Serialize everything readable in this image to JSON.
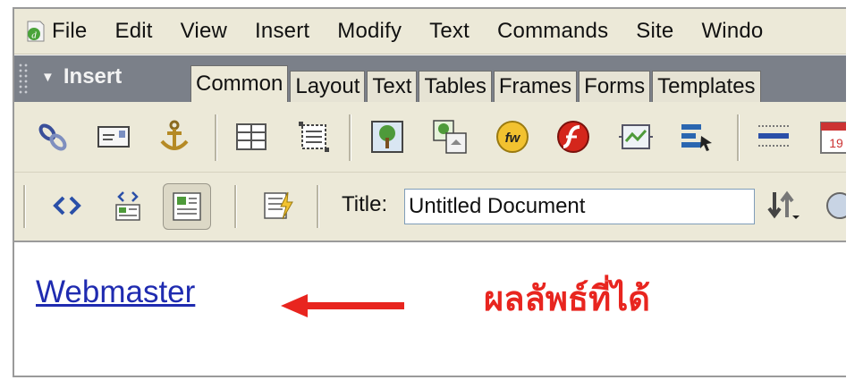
{
  "menubar": {
    "items": [
      "File",
      "Edit",
      "View",
      "Insert",
      "Modify",
      "Text",
      "Commands",
      "Site",
      "Windo"
    ]
  },
  "insert_bar": {
    "title": "Insert",
    "tabs": [
      "Common",
      "Layout",
      "Text",
      "Tables",
      "Frames",
      "Forms",
      "Templates"
    ],
    "active_tab": "Common"
  },
  "common_toolbar": {
    "icons": [
      "hyperlink-icon",
      "email-link-icon",
      "named-anchor-icon",
      "table-icon",
      "layer-icon",
      "image-icon",
      "rollover-image-icon",
      "fireworks-html-icon",
      "flash-icon",
      "navigation-bar-icon",
      "horizontal-rule-icon",
      "date-icon"
    ]
  },
  "document_toolbar": {
    "title_label": "Title:",
    "title_value": "Untitled Document",
    "icons": [
      "code-view-icon",
      "split-view-icon",
      "design-view-icon",
      "live-data-icon",
      "file-management-icon",
      "preview-browser-icon"
    ]
  },
  "document": {
    "link_text": "Webmaster",
    "annotation": "ผลลัพธ์ที่ได้"
  },
  "colors": {
    "link": "#1f2bb0",
    "annotation": "#e8251f",
    "insert_bar": "#7b8089",
    "chrome": "#ece9d8"
  }
}
